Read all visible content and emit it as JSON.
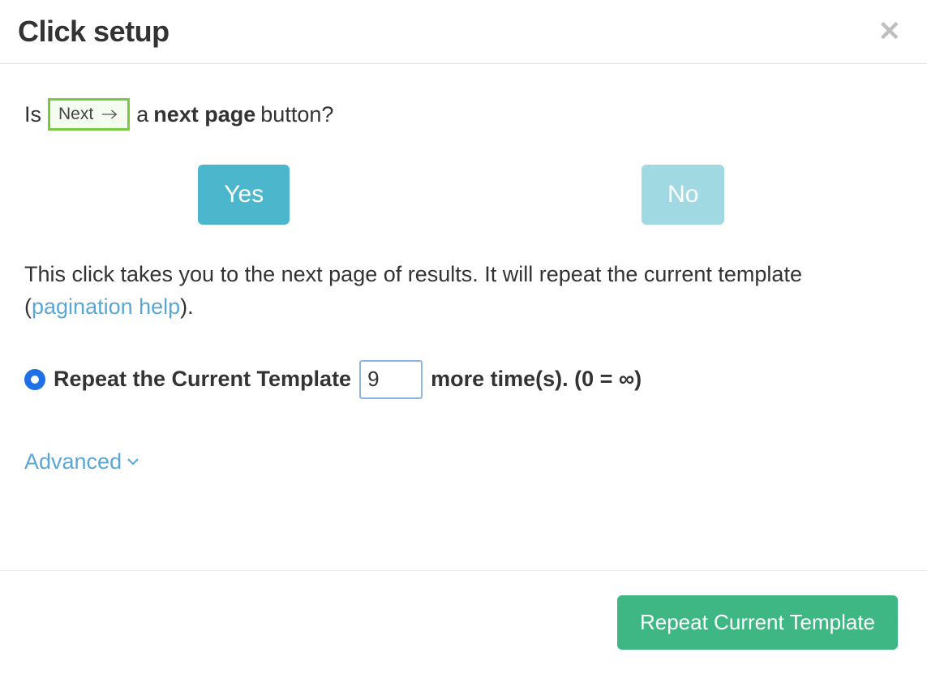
{
  "header": {
    "title": "Click setup"
  },
  "question": {
    "prefix": "Is",
    "pill_label": "Next",
    "middle": "a",
    "emphasis": "next page",
    "suffix": "button?"
  },
  "buttons": {
    "yes": "Yes",
    "no": "No"
  },
  "description": {
    "text_before_link": "This click takes you to the next page of results. It will repeat the current template (",
    "link_text": "pagination help",
    "text_after_link": ")."
  },
  "repeat": {
    "label_before": "Repeat the Current Template",
    "value": "9",
    "label_after": "more time(s). (0 = ∞)"
  },
  "advanced": {
    "label": "Advanced"
  },
  "footer": {
    "submit": "Repeat Current Template"
  }
}
